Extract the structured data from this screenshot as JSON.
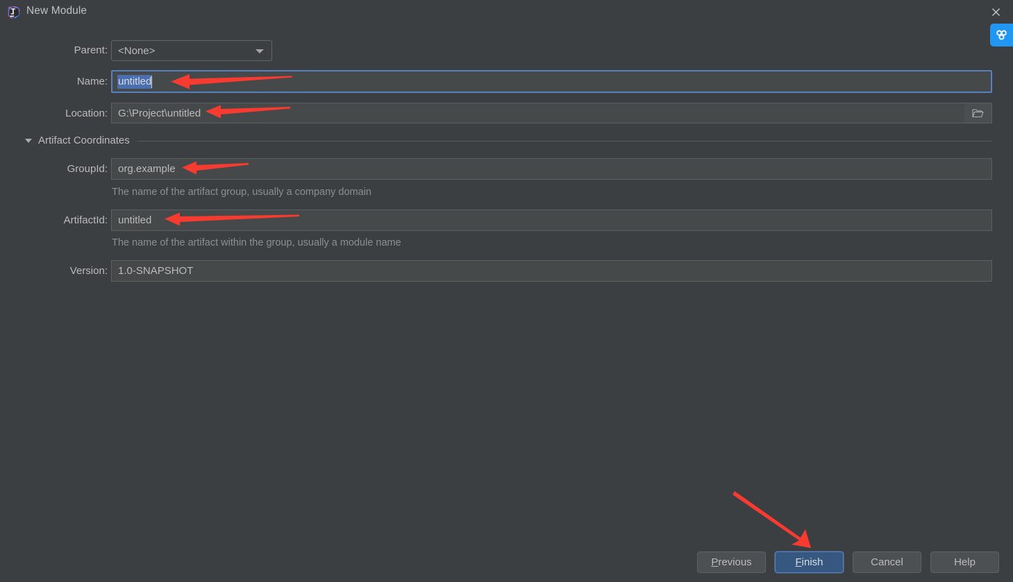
{
  "window": {
    "title": "New Module",
    "app_icon": "intellij-idea-icon",
    "close_icon": "close-icon",
    "accent_focus": "#5781c0",
    "background": "#3c3f41",
    "field_background": "#45494a",
    "selection_color": "#4b6eaf",
    "annotation_color": "#f03c32"
  },
  "overlay": {
    "netdisk_icon": "baidu-netdisk-icon",
    "netdisk_color": "#2196f3"
  },
  "form": {
    "parent": {
      "label": "Parent:",
      "value": "<None>",
      "placeholder": "<None>",
      "options": [
        "<None>"
      ]
    },
    "name": {
      "label": "Name:",
      "value": "untitled",
      "placeholder": "untitled",
      "selected": true,
      "focused": true
    },
    "location": {
      "label": "Location:",
      "value": "G:\\Project\\untitled",
      "placeholder": "G:\\Project\\untitled",
      "browse_icon": "folder-icon"
    }
  },
  "artifact_section": {
    "label": "Artifact Coordinates",
    "expanded": true,
    "collapse_icon": "chevron-down-icon",
    "fields": {
      "group_id": {
        "label": "GroupId:",
        "value": "org.example",
        "placeholder": "org.example",
        "hint": "The name of the artifact group, usually a company domain"
      },
      "artifact_id": {
        "label": "ArtifactId:",
        "value": "untitled",
        "placeholder": "untitled",
        "hint": "The name of the artifact within the group, usually a module name"
      },
      "version": {
        "label": "Version:",
        "value": "1.0-SNAPSHOT",
        "placeholder": "1.0-SNAPSHOT",
        "hint": ""
      }
    }
  },
  "buttons": {
    "previous": {
      "label": "Previous",
      "mnemonic": "P",
      "rest": "revious"
    },
    "finish": {
      "label": "Finish",
      "mnemonic": "F",
      "rest": "inish",
      "primary": true
    },
    "cancel": {
      "label": "Cancel"
    },
    "help": {
      "label": "Help"
    }
  },
  "annotations": [
    {
      "name": "arrow-to-name-field",
      "direction": "left",
      "target": "name"
    },
    {
      "name": "arrow-to-location-field",
      "direction": "left",
      "target": "location"
    },
    {
      "name": "arrow-to-groupid-field",
      "direction": "left",
      "target": "group_id"
    },
    {
      "name": "arrow-to-artifactid-field",
      "direction": "left",
      "target": "artifact_id"
    },
    {
      "name": "arrow-to-finish-button",
      "direction": "down-right",
      "target": "finish"
    }
  ]
}
